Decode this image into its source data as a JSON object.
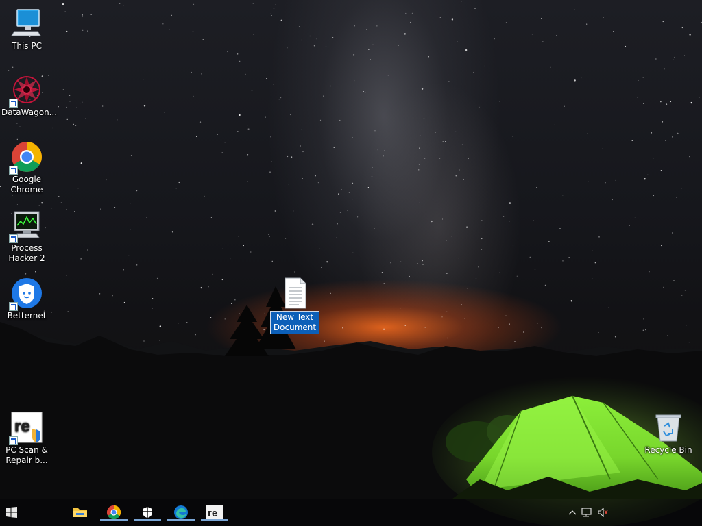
{
  "desktop": {
    "icons": [
      {
        "name": "this-pc",
        "label": "This PC",
        "shortcut": false
      },
      {
        "name": "datawagon",
        "label": "DataWagon...",
        "shortcut": true
      },
      {
        "name": "google-chrome",
        "label": "Google Chrome",
        "shortcut": true
      },
      {
        "name": "process-hacker-2",
        "label": "Process Hacker 2",
        "shortcut": true
      },
      {
        "name": "betternet",
        "label": "Betternet",
        "shortcut": true
      },
      {
        "name": "pc-scan-repair",
        "label": "PC Scan & Repair b...",
        "shortcut": true
      },
      {
        "name": "recycle-bin",
        "label": "Recycle Bin",
        "shortcut": false
      }
    ],
    "selected_file": {
      "label": "New Text Document",
      "state": "renaming"
    }
  },
  "taskbar": {
    "start_icon": "windows-logo-icon",
    "pinned": [
      {
        "name": "file-explorer",
        "icon": "folder-icon"
      },
      {
        "name": "chrome",
        "icon": "chrome-icon"
      },
      {
        "name": "betternet",
        "icon": "shield-icon"
      },
      {
        "name": "edge",
        "icon": "edge-icon"
      },
      {
        "name": "reimage",
        "icon": "reimage-icon"
      }
    ],
    "tray": {
      "chevron": "chevron-up-icon",
      "network": "network-icon",
      "volume": "volume-muted-icon"
    }
  },
  "colors": {
    "selection": "#0c5fb8",
    "tent": "#8ee03a",
    "accent": "#7aa6d6"
  }
}
